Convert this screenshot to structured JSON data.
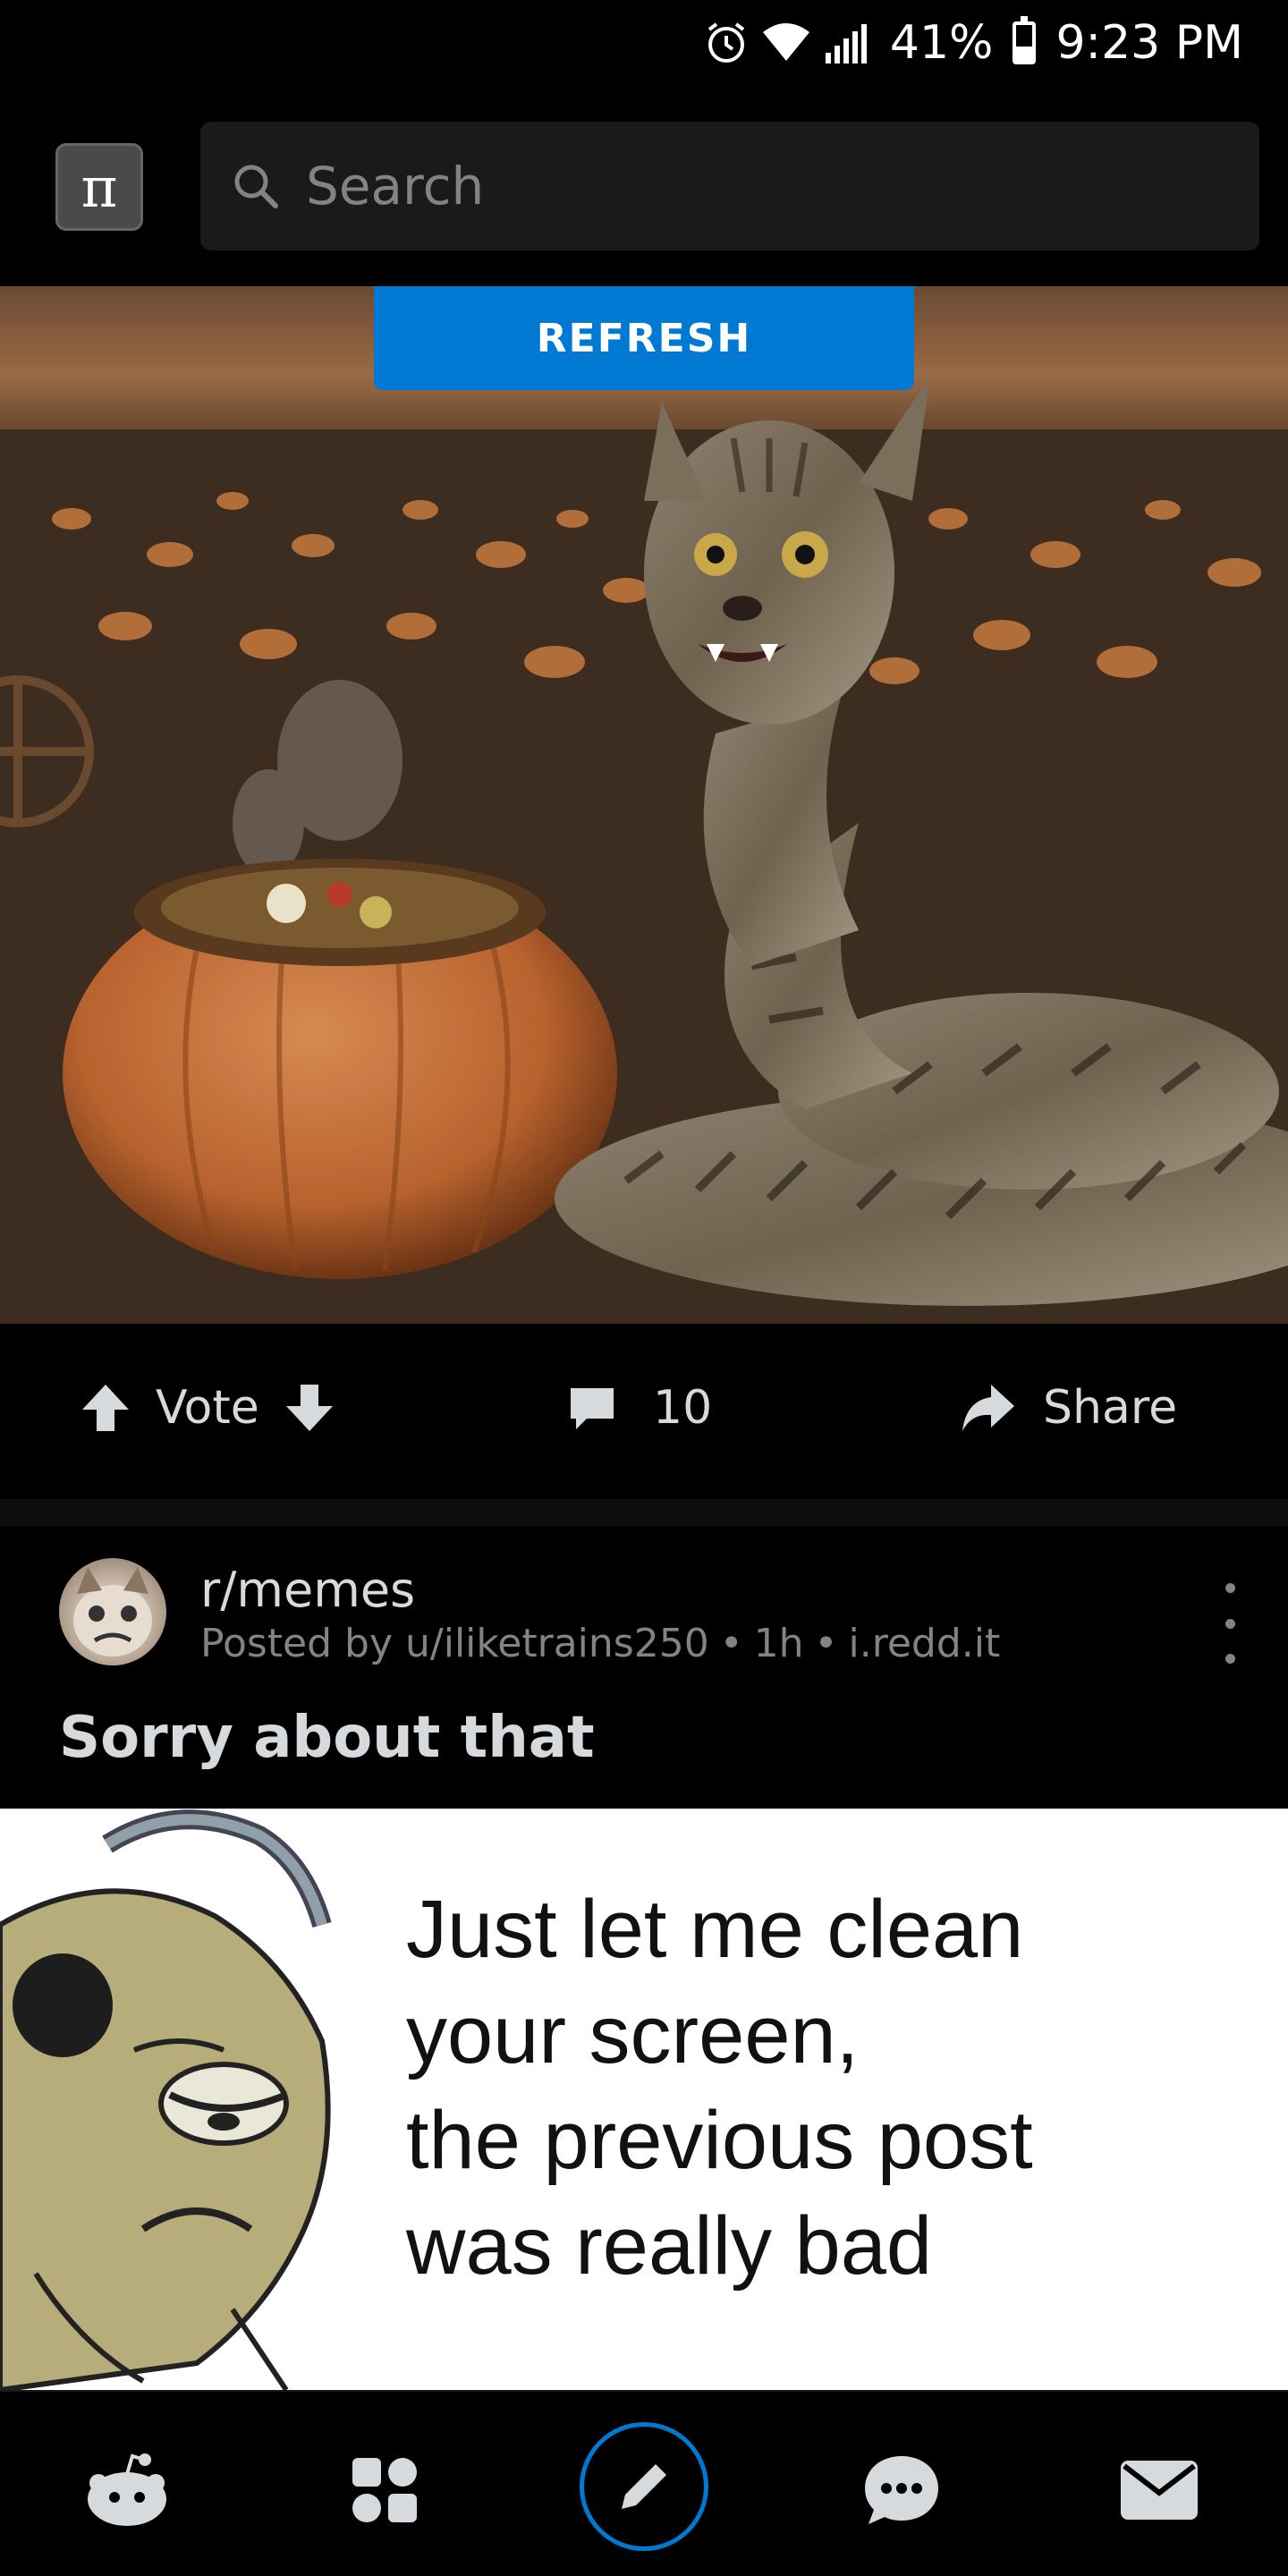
{
  "status_bar": {
    "battery": "41%",
    "battery_level": 0.41,
    "time": "9:23 PM",
    "icons": [
      "alarm-icon",
      "wifi-icon",
      "signal-icon",
      "battery-icon"
    ]
  },
  "header": {
    "app_icon": "pi-icon",
    "app_icon_glyph": "π",
    "search_placeholder": "Search"
  },
  "feed": {
    "refresh_label": "REFRESH",
    "post1": {
      "vote_label": "Vote",
      "comment_count": "10",
      "share_label": "Share"
    },
    "post2": {
      "subreddit": "r/memes",
      "meta": {
        "posted_by": "Posted by u/iliketrains250",
        "separator": "•",
        "age": "1h",
        "domain": "i.redd.it"
      },
      "title": "Sorry about that",
      "meme_lines": [
        "Just let me clean",
        "your screen,",
        "the previous post",
        "was really bad"
      ]
    }
  },
  "bottom_nav": {
    "items": [
      "home-icon",
      "popular-icon",
      "create-post-icon",
      "chat-icon",
      "inbox-icon"
    ]
  },
  "colors": {
    "accent": "#0079d3",
    "background": "#000000",
    "text": "#d7dadc",
    "muted": "#818384"
  }
}
